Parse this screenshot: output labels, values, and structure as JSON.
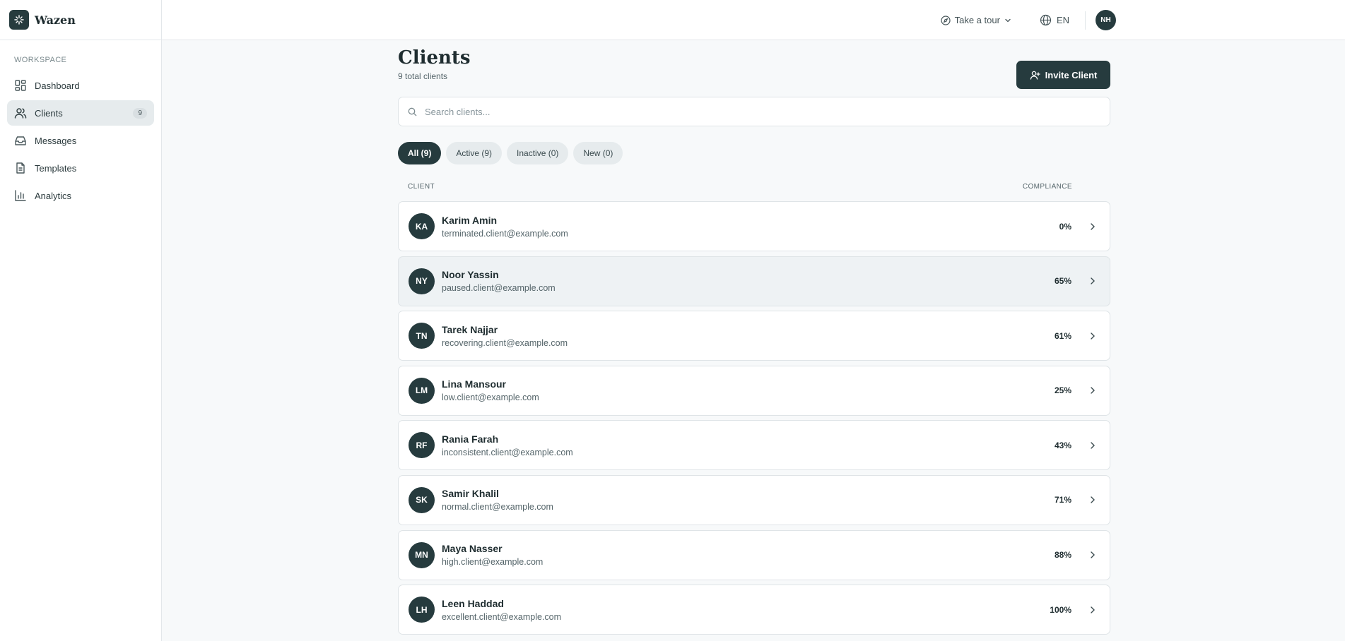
{
  "brand": {
    "name": "Wazen"
  },
  "sidebar": {
    "section_label": "WORKSPACE",
    "items": [
      {
        "label": "Dashboard",
        "icon": "dashboard-icon"
      },
      {
        "label": "Clients",
        "icon": "users-icon",
        "badge": "9",
        "active": true
      },
      {
        "label": "Messages",
        "icon": "inbox-icon"
      },
      {
        "label": "Templates",
        "icon": "file-icon"
      },
      {
        "label": "Analytics",
        "icon": "bar-chart-icon"
      }
    ]
  },
  "header": {
    "tour_label": "Take a tour",
    "lang_label": "EN",
    "user_initials": "NH"
  },
  "page": {
    "title": "Clients",
    "subtitle": "9 total clients",
    "invite_label": "Invite Client",
    "search_placeholder": "Search clients...",
    "filters": [
      {
        "label": "All (9)",
        "active": true
      },
      {
        "label": "Active (9)"
      },
      {
        "label": "Inactive (0)"
      },
      {
        "label": "New (0)"
      }
    ],
    "columns": {
      "client": "CLIENT",
      "compliance": "COMPLIANCE"
    },
    "clients": [
      {
        "initials": "KA",
        "name": "Karim Amin",
        "email": "terminated.client@example.com",
        "compliance": "0%"
      },
      {
        "initials": "NY",
        "name": "Noor Yassin",
        "email": "paused.client@example.com",
        "compliance": "65%"
      },
      {
        "initials": "TN",
        "name": "Tarek Najjar",
        "email": "recovering.client@example.com",
        "compliance": "61%"
      },
      {
        "initials": "LM",
        "name": "Lina Mansour",
        "email": "low.client@example.com",
        "compliance": "25%"
      },
      {
        "initials": "RF",
        "name": "Rania Farah",
        "email": "inconsistent.client@example.com",
        "compliance": "43%"
      },
      {
        "initials": "SK",
        "name": "Samir Khalil",
        "email": "normal.client@example.com",
        "compliance": "71%"
      },
      {
        "initials": "MN",
        "name": "Maya Nasser",
        "email": "high.client@example.com",
        "compliance": "88%"
      },
      {
        "initials": "LH",
        "name": "Leen Haddad",
        "email": "excellent.client@example.com",
        "compliance": "100%"
      }
    ]
  },
  "colors": {
    "accent": "#263b3e",
    "background": "#f7f9fa",
    "hover_row": "#eef2f4"
  }
}
